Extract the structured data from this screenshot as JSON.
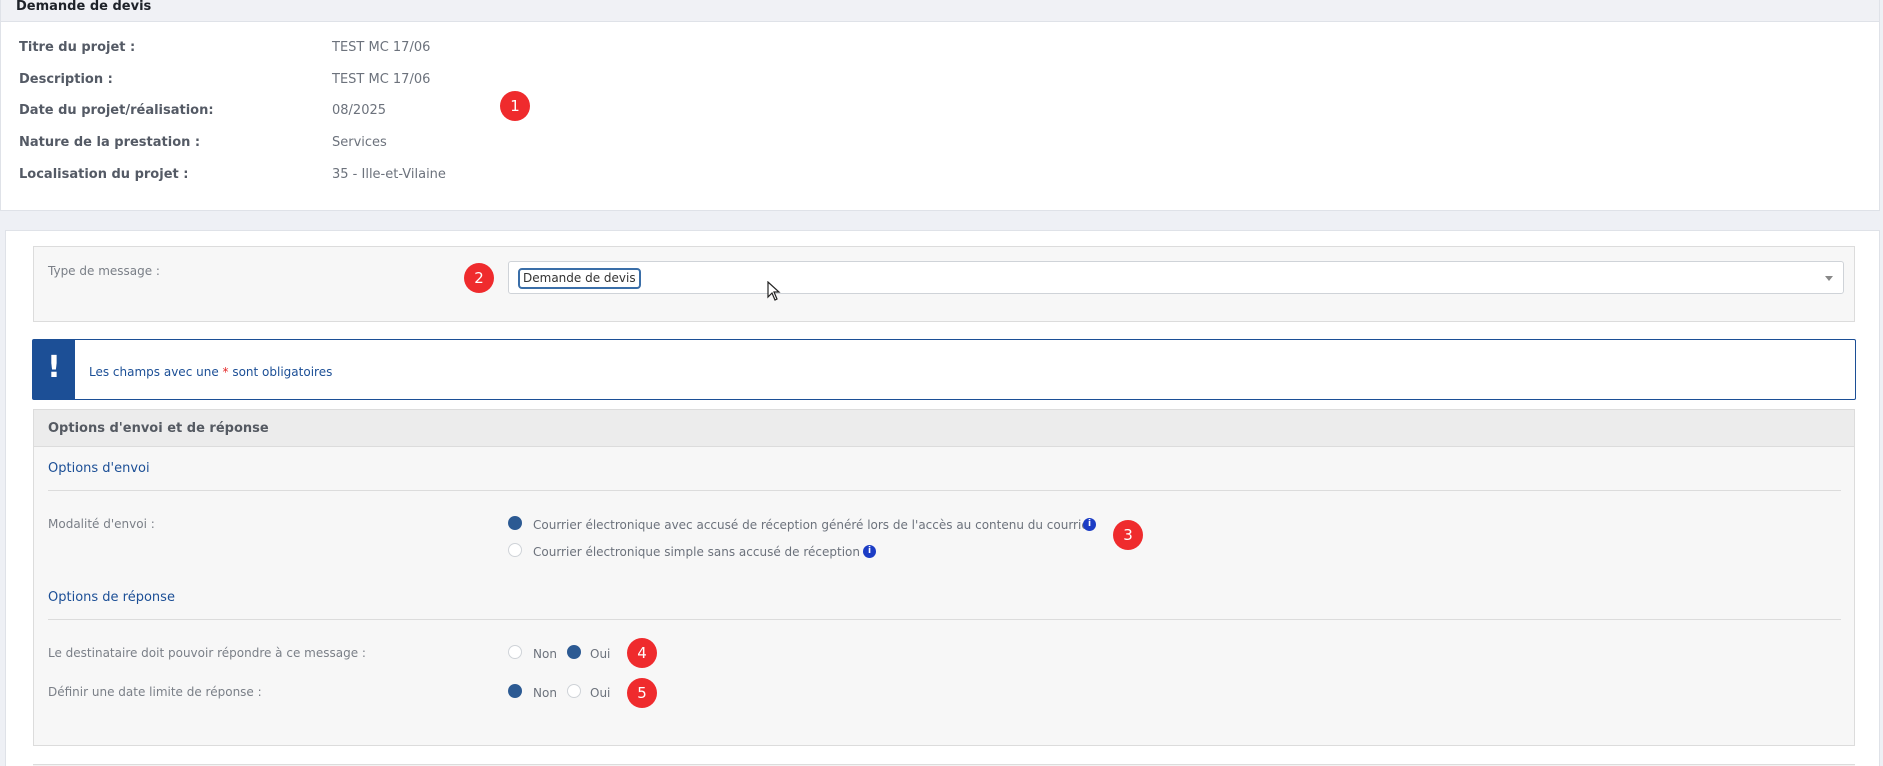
{
  "header": {
    "title": "Demande de devis"
  },
  "project_info": [
    {
      "label": "Titre du projet :",
      "value": "TEST MC 17/06"
    },
    {
      "label": "Description :",
      "value": "TEST MC 17/06"
    },
    {
      "label": "Date du projet/réalisation:",
      "value": "08/2025"
    },
    {
      "label": "Nature de la prestation :",
      "value": "Services"
    },
    {
      "label": "Localisation du projet :",
      "value": "35 - Ille-et-Vilaine"
    }
  ],
  "badges": [
    "1",
    "2",
    "3",
    "4",
    "5"
  ],
  "message_type": {
    "label": "Type de message :",
    "selected": "Demande de devis"
  },
  "alert": {
    "icon": "!",
    "text_before": "Les champs avec une ",
    "asterisk": "*",
    "text_after": " sont obligatoires"
  },
  "options": {
    "header": "Options d'envoi et de réponse",
    "send_section_title": "Options d'envoi",
    "send_mode": {
      "label": "Modalité d'envoi :",
      "choices": [
        {
          "label": "Courrier électronique avec accusé de réception généré lors de l'accès au contenu du courrier",
          "checked": true
        },
        {
          "label": "Courrier électronique simple sans accusé de réception",
          "checked": false
        }
      ]
    },
    "reply_section_title": "Options de réponse",
    "can_reply": {
      "label": "Le destinataire doit pouvoir répondre à ce message :",
      "choices": [
        {
          "label": "Non",
          "checked": false
        },
        {
          "label": "Oui",
          "checked": true
        }
      ]
    },
    "deadline": {
      "label": "Définir une date limite de réponse :",
      "choices": [
        {
          "label": "Non",
          "checked": true
        },
        {
          "label": "Oui",
          "checked": false
        }
      ]
    }
  },
  "icons": {
    "info": "i",
    "colors": {
      "primary": "#1c4f96",
      "badge": "#ef2b2d",
      "radio_checked": "#2c5a93",
      "info_icon": "#1c3dc5"
    }
  }
}
